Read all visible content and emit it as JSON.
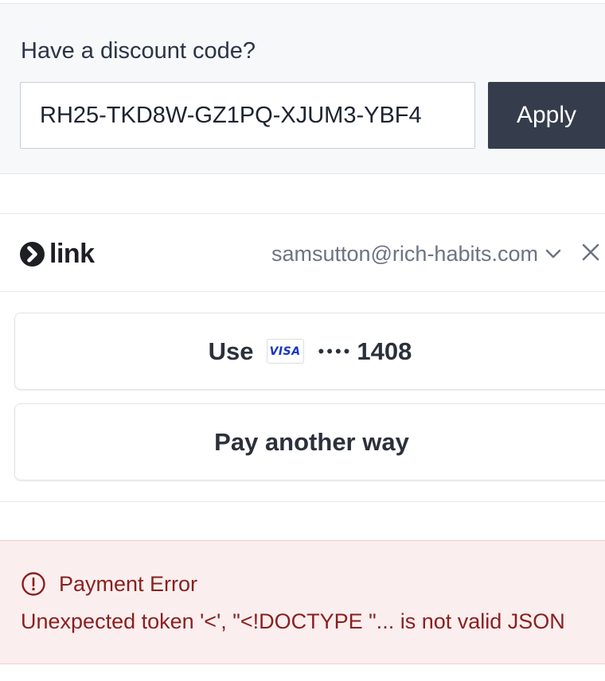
{
  "discount": {
    "heading": "Have a discount code?",
    "code_value": "RH25-TKD8W-GZ1PQ-XJUM3-YBF4",
    "apply_label": "Apply"
  },
  "link": {
    "logo_text": "link",
    "email": "samsutton@rich-habits.com"
  },
  "payment": {
    "use_label": "Use",
    "card_brand": "VISA",
    "card_dots": "••••",
    "card_last4": "1408",
    "pay_another_label": "Pay another way"
  },
  "error": {
    "title": "Payment Error",
    "message": "Unexpected token '<', \"<!DOCTYPE \"... is not valid JSON"
  },
  "colors": {
    "apply_button_bg": "#353c4b",
    "error_bg": "#fbeeee",
    "error_text": "#8a1f1f",
    "visa_blue": "#1434cb"
  },
  "icons": [
    "link-logo-icon",
    "chevron-down-icon",
    "close-icon",
    "alert-circle-icon"
  ]
}
